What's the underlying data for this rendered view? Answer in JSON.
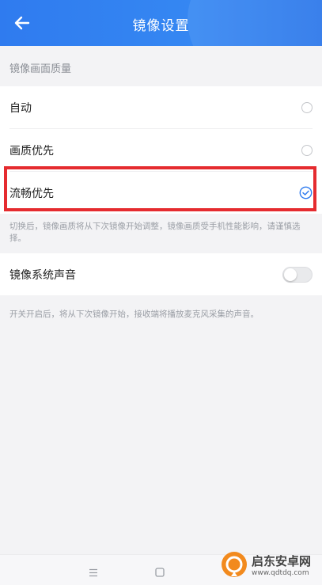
{
  "header": {
    "title": "镜像设置",
    "back_icon": "arrow-left-icon",
    "background_color": "#3183f0"
  },
  "quality": {
    "section_label": "镜像画面质量",
    "options": [
      {
        "label": "自动",
        "selected": false
      },
      {
        "label": "画质优先",
        "selected": false
      },
      {
        "label": "流畅优先",
        "selected": true
      }
    ],
    "note": "切换后，镜像画质将从下次镜像开始调整，镜像画质受手机性能影响，请谨慎选择。"
  },
  "sound": {
    "label": "镜像系统声音",
    "enabled": false,
    "note": "开关开启后，将从下次镜像开始，接收端将播放麦克风采集的声音。"
  },
  "colors": {
    "accent": "#2f7bef",
    "highlight_box": "#e52b2f"
  },
  "watermark": {
    "name": "启东安卓网",
    "url": "www.qdtdq.com"
  }
}
